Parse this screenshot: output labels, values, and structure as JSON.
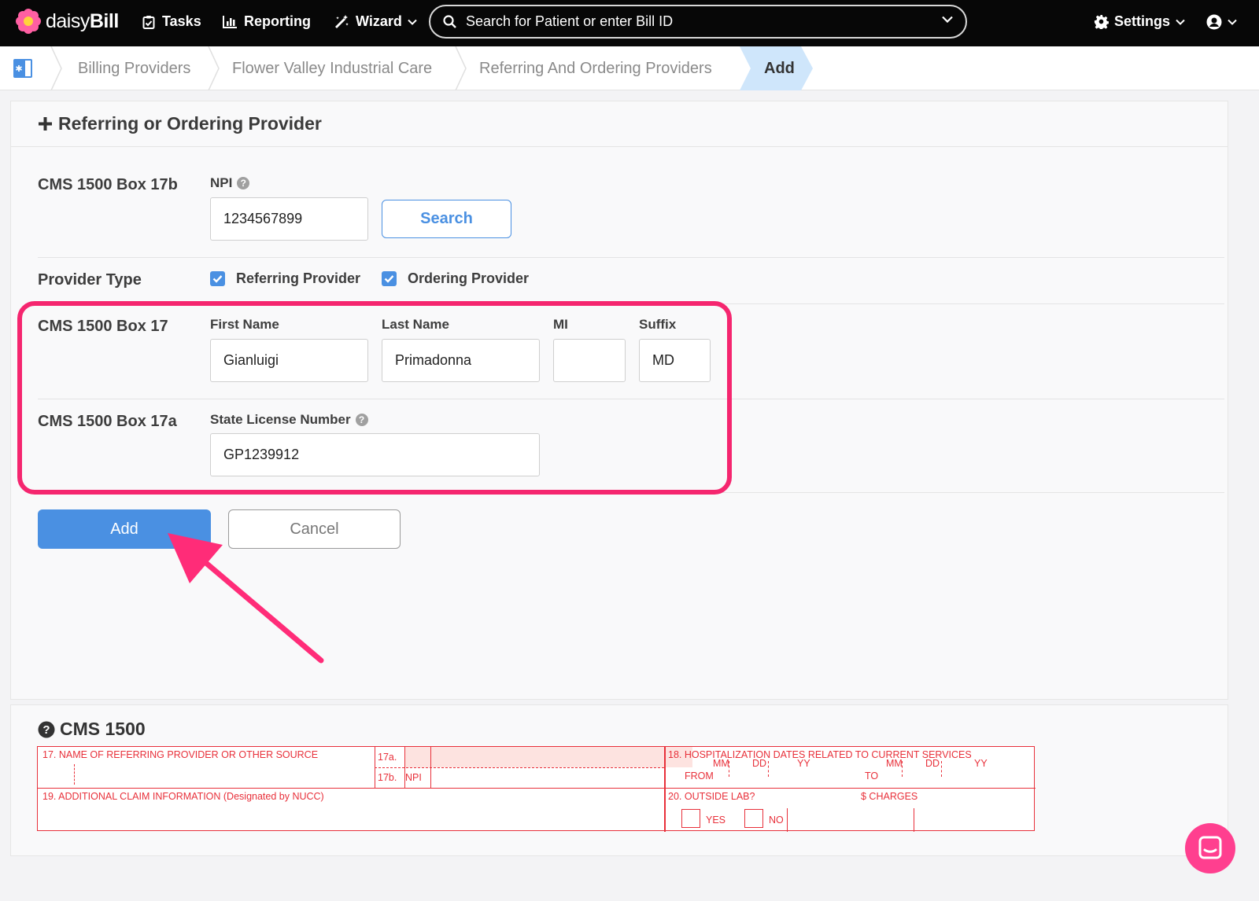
{
  "app": {
    "brand_light": "daisy",
    "brand_bold": "Bill"
  },
  "nav": {
    "tasks": "Tasks",
    "reporting": "Reporting",
    "wizard": "Wizard",
    "search_placeholder": "Search for Patient or enter Bill ID",
    "settings": "Settings"
  },
  "breadcrumbs": [
    "Billing Providers",
    "Flower Valley Industrial Care",
    "Referring And Ordering Providers",
    "Add"
  ],
  "panel": {
    "title": "Referring or Ordering Provider"
  },
  "form": {
    "box17b": {
      "label": "CMS 1500 Box 17b",
      "npi_label": "NPI",
      "npi_value": "1234567899",
      "search_button": "Search"
    },
    "provider_type": {
      "label": "Provider Type",
      "referring": "Referring Provider",
      "ordering": "Ordering Provider",
      "referring_checked": true,
      "ordering_checked": true
    },
    "box17": {
      "label": "CMS 1500 Box 17",
      "first_name_label": "First Name",
      "first_name": "Gianluigi",
      "last_name_label": "Last Name",
      "last_name": "Primadonna",
      "mi_label": "MI",
      "mi": "",
      "suffix_label": "Suffix",
      "suffix": "MD"
    },
    "box17a": {
      "label": "CMS 1500 Box 17a",
      "license_label": "State License Number",
      "license_value": "GP1239912"
    },
    "add_button": "Add",
    "cancel_button": "Cancel"
  },
  "cms1500": {
    "title": "CMS 1500",
    "f17": "17. NAME OF REFERRING PROVIDER OR OTHER SOURCE",
    "f17a": "17a.",
    "f17b": "17b.",
    "npi": "NPI",
    "f18": "18. HOSPITALIZATION DATES RELATED TO CURRENT SERVICES",
    "mm": "MM",
    "dd": "DD",
    "yy": "YY",
    "from": "FROM",
    "to": "TO",
    "f19": "19. ADDITIONAL CLAIM INFORMATION (Designated by NUCC)",
    "f20": "20. OUTSIDE LAB?",
    "charges": "$ CHARGES",
    "yes": "YES",
    "no": "NO"
  },
  "colors": {
    "accent": "#4a90e2",
    "highlight": "#f5266f",
    "form_red": "#e8303a",
    "breadcrumb_active": "#cfe6fb"
  }
}
